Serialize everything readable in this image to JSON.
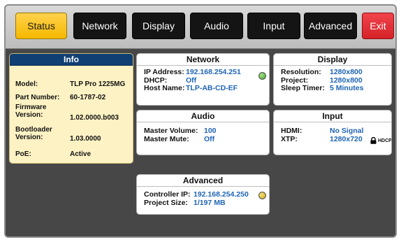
{
  "tabs": [
    {
      "label": "Status",
      "state": "active"
    },
    {
      "label": "Network"
    },
    {
      "label": "Display"
    },
    {
      "label": "Audio"
    },
    {
      "label": "Input"
    },
    {
      "label": "Advanced"
    },
    {
      "label": "Exit",
      "state": "exit"
    }
  ],
  "info": {
    "title": "Info",
    "model_label": "Model:",
    "model": "TLP Pro 1225MG",
    "part_label": "Part Number:",
    "part": "60-1787-02",
    "fw_label_1": "Firmware",
    "fw_label_2": "Version:",
    "fw": "1.02.0000.b003",
    "bl_label_1": "Bootloader",
    "bl_label_2": "Version:",
    "bl": "1.03.0000",
    "poe_label": "PoE:",
    "poe": "Active"
  },
  "network": {
    "title": "Network",
    "ip_label": "IP Address:",
    "ip": "192.168.254.251",
    "dhcp_label": "DHCP:",
    "dhcp": "Off",
    "host_label": "Host Name:",
    "host": "TLP-AB-CD-EF",
    "status_color": "#3aa02a"
  },
  "display": {
    "title": "Display",
    "res_label": "Resolution:",
    "res": "1280x800",
    "proj_label": "Project:",
    "proj": "1280x800",
    "sleep_label": "Sleep Timer:",
    "sleep": "5 Minutes"
  },
  "audio": {
    "title": "Audio",
    "vol_label": "Master Volume:",
    "vol": "100",
    "mute_label": "Master Mute:",
    "mute": "Off"
  },
  "input": {
    "title": "Input",
    "hdmi_label": "HDMI:",
    "hdmi": "No Signal",
    "xtp_label": "XTP:",
    "xtp": "1280x720",
    "hdcp": "HDCP"
  },
  "advanced": {
    "title": "Advanced",
    "ctrl_label": "Controller IP:",
    "ctrl": "192.168.254.250",
    "size_label": "Project Size:",
    "size": "1/197 MB",
    "status_color": "#c9a514"
  },
  "colors": {
    "accent": "#f5b800",
    "exit": "#d62229",
    "value": "#1e64b4",
    "info_header": "#0f3f73"
  }
}
